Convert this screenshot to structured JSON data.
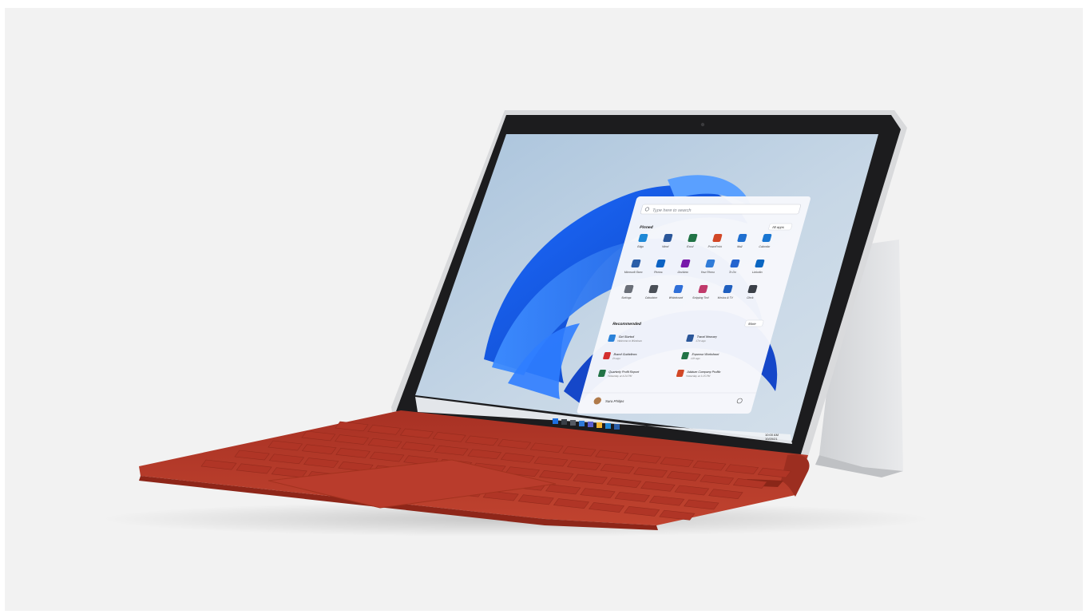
{
  "product": {
    "device": "Surface Go tablet with red Type Cover",
    "colors": {
      "background": "#f2f2f2",
      "keyboard": "#b73a2b",
      "bezel": "#1c1c1e",
      "chassis": "#d9dadc",
      "wallpaper_blue": "#2b6fd6",
      "start_menu": "#f6f7fb"
    }
  },
  "start_menu": {
    "search_placeholder": "Type here to search",
    "pinned_label": "Pinned",
    "all_apps_label": "All apps",
    "recommended_label": "Recommended",
    "more_label": "More",
    "user_name": "Sara Philips",
    "apps": [
      {
        "name": "Edge",
        "color": "#1e88d6"
      },
      {
        "name": "Word",
        "color": "#2b579a"
      },
      {
        "name": "Excel",
        "color": "#217346"
      },
      {
        "name": "PowerPoint",
        "color": "#d24726"
      },
      {
        "name": "Mail",
        "color": "#1f6fd0"
      },
      {
        "name": "Calendar",
        "color": "#1976d2"
      },
      {
        "name": "Microsoft Store",
        "color": "#2a5ea8"
      },
      {
        "name": "Photos",
        "color": "#0b62c4"
      },
      {
        "name": "OneNote",
        "color": "#7719aa"
      },
      {
        "name": "Your Phone",
        "color": "#2f7bd8"
      },
      {
        "name": "To Do",
        "color": "#2564cf"
      },
      {
        "name": "LinkedIn",
        "color": "#0a66c2"
      },
      {
        "name": "Settings",
        "color": "#6a6f78"
      },
      {
        "name": "Calculator",
        "color": "#4a4f57"
      },
      {
        "name": "Whiteboard",
        "color": "#2f6fd8"
      },
      {
        "name": "Snipping Tool",
        "color": "#c03a6b"
      },
      {
        "name": "Movies & TV",
        "color": "#1f5fbf"
      },
      {
        "name": "Clock",
        "color": "#3a3f47"
      }
    ],
    "recommended": [
      {
        "title": "Get Started",
        "sub": "Welcome to Windows",
        "color": "#2b82d9"
      },
      {
        "title": "Travel Itinerary",
        "sub": "17m ago",
        "color": "#2b579a"
      },
      {
        "title": "Brand Guidelines",
        "sub": "2h ago",
        "color": "#d32f2f"
      },
      {
        "title": "Expense Worksheet",
        "sub": "12h ago",
        "color": "#217346"
      },
      {
        "title": "Quarterly Profit Report",
        "sub": "Yesterday at 4:24 PM",
        "color": "#217346"
      },
      {
        "title": "Adatum Company Profile",
        "sub": "Yesterday at 1:15 PM",
        "color": "#d24726"
      }
    ]
  },
  "taskbar": {
    "time": "10:00 AM",
    "date": "10/20/21"
  }
}
